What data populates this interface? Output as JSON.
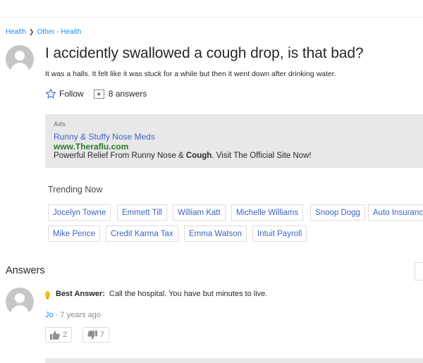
{
  "breadcrumb": {
    "parent": "Health",
    "child": "Other - Health"
  },
  "question": {
    "title": "I accidently swallowed a cough drop, is that bad?",
    "body": "It was a halls. It felt like it was stuck for a while but then it went down after drinking water.",
    "follow_label": "Follow",
    "answers_count": "8 answers"
  },
  "ad": {
    "label": "Ads",
    "title": "Runny & Stuffy Nose Meds",
    "url": "www.Theraflu.com",
    "desc_before": "Powerful Relief From Runny Nose & ",
    "desc_bold": "Cough",
    "desc_after": ". Visit The Official Site Now!"
  },
  "trending": {
    "label": "Trending Now",
    "tags": [
      "Jocelyn Towne",
      "Emmett Till",
      "William Katt",
      "Michelle Williams",
      "Snoop Dogg",
      "Auto Insurance",
      "Mike Pence",
      "Credit Karma Tax",
      "Emma Watson",
      "Intuit Payroll"
    ]
  },
  "answers": {
    "heading": "Answers",
    "best": {
      "label": "Best Answer:",
      "text": "Call the hospital. You have but minutes to live.",
      "author": "Jo",
      "separator": " · ",
      "time": "7 years ago",
      "thumbs_up": "2",
      "thumbs_down": "7"
    }
  },
  "colors": {
    "link": "#3c63c5",
    "breadcrumb_link": "#188fff",
    "ad_url": "#2a7a2a",
    "ad_bg": "#e8e8e8",
    "bulb": "#f0c400"
  },
  "icons": [
    "chevron-right-icon",
    "star-outline-icon",
    "answers-box-icon",
    "avatar-icon",
    "bulb-icon",
    "thumbs-up-icon",
    "thumbs-down-icon"
  ]
}
